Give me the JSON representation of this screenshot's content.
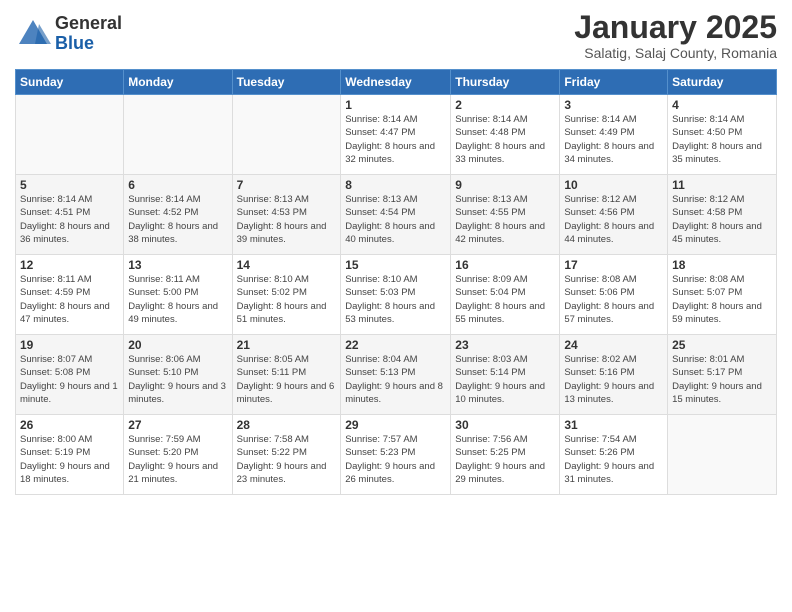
{
  "logo": {
    "general": "General",
    "blue": "Blue"
  },
  "title": "January 2025",
  "subtitle": "Salatig, Salaj County, Romania",
  "days_of_week": [
    "Sunday",
    "Monday",
    "Tuesday",
    "Wednesday",
    "Thursday",
    "Friday",
    "Saturday"
  ],
  "weeks": [
    [
      {
        "num": "",
        "info": ""
      },
      {
        "num": "",
        "info": ""
      },
      {
        "num": "",
        "info": ""
      },
      {
        "num": "1",
        "info": "Sunrise: 8:14 AM\nSunset: 4:47 PM\nDaylight: 8 hours and 32 minutes."
      },
      {
        "num": "2",
        "info": "Sunrise: 8:14 AM\nSunset: 4:48 PM\nDaylight: 8 hours and 33 minutes."
      },
      {
        "num": "3",
        "info": "Sunrise: 8:14 AM\nSunset: 4:49 PM\nDaylight: 8 hours and 34 minutes."
      },
      {
        "num": "4",
        "info": "Sunrise: 8:14 AM\nSunset: 4:50 PM\nDaylight: 8 hours and 35 minutes."
      }
    ],
    [
      {
        "num": "5",
        "info": "Sunrise: 8:14 AM\nSunset: 4:51 PM\nDaylight: 8 hours and 36 minutes."
      },
      {
        "num": "6",
        "info": "Sunrise: 8:14 AM\nSunset: 4:52 PM\nDaylight: 8 hours and 38 minutes."
      },
      {
        "num": "7",
        "info": "Sunrise: 8:13 AM\nSunset: 4:53 PM\nDaylight: 8 hours and 39 minutes."
      },
      {
        "num": "8",
        "info": "Sunrise: 8:13 AM\nSunset: 4:54 PM\nDaylight: 8 hours and 40 minutes."
      },
      {
        "num": "9",
        "info": "Sunrise: 8:13 AM\nSunset: 4:55 PM\nDaylight: 8 hours and 42 minutes."
      },
      {
        "num": "10",
        "info": "Sunrise: 8:12 AM\nSunset: 4:56 PM\nDaylight: 8 hours and 44 minutes."
      },
      {
        "num": "11",
        "info": "Sunrise: 8:12 AM\nSunset: 4:58 PM\nDaylight: 8 hours and 45 minutes."
      }
    ],
    [
      {
        "num": "12",
        "info": "Sunrise: 8:11 AM\nSunset: 4:59 PM\nDaylight: 8 hours and 47 minutes."
      },
      {
        "num": "13",
        "info": "Sunrise: 8:11 AM\nSunset: 5:00 PM\nDaylight: 8 hours and 49 minutes."
      },
      {
        "num": "14",
        "info": "Sunrise: 8:10 AM\nSunset: 5:02 PM\nDaylight: 8 hours and 51 minutes."
      },
      {
        "num": "15",
        "info": "Sunrise: 8:10 AM\nSunset: 5:03 PM\nDaylight: 8 hours and 53 minutes."
      },
      {
        "num": "16",
        "info": "Sunrise: 8:09 AM\nSunset: 5:04 PM\nDaylight: 8 hours and 55 minutes."
      },
      {
        "num": "17",
        "info": "Sunrise: 8:08 AM\nSunset: 5:06 PM\nDaylight: 8 hours and 57 minutes."
      },
      {
        "num": "18",
        "info": "Sunrise: 8:08 AM\nSunset: 5:07 PM\nDaylight: 8 hours and 59 minutes."
      }
    ],
    [
      {
        "num": "19",
        "info": "Sunrise: 8:07 AM\nSunset: 5:08 PM\nDaylight: 9 hours and 1 minute."
      },
      {
        "num": "20",
        "info": "Sunrise: 8:06 AM\nSunset: 5:10 PM\nDaylight: 9 hours and 3 minutes."
      },
      {
        "num": "21",
        "info": "Sunrise: 8:05 AM\nSunset: 5:11 PM\nDaylight: 9 hours and 6 minutes."
      },
      {
        "num": "22",
        "info": "Sunrise: 8:04 AM\nSunset: 5:13 PM\nDaylight: 9 hours and 8 minutes."
      },
      {
        "num": "23",
        "info": "Sunrise: 8:03 AM\nSunset: 5:14 PM\nDaylight: 9 hours and 10 minutes."
      },
      {
        "num": "24",
        "info": "Sunrise: 8:02 AM\nSunset: 5:16 PM\nDaylight: 9 hours and 13 minutes."
      },
      {
        "num": "25",
        "info": "Sunrise: 8:01 AM\nSunset: 5:17 PM\nDaylight: 9 hours and 15 minutes."
      }
    ],
    [
      {
        "num": "26",
        "info": "Sunrise: 8:00 AM\nSunset: 5:19 PM\nDaylight: 9 hours and 18 minutes."
      },
      {
        "num": "27",
        "info": "Sunrise: 7:59 AM\nSunset: 5:20 PM\nDaylight: 9 hours and 21 minutes."
      },
      {
        "num": "28",
        "info": "Sunrise: 7:58 AM\nSunset: 5:22 PM\nDaylight: 9 hours and 23 minutes."
      },
      {
        "num": "29",
        "info": "Sunrise: 7:57 AM\nSunset: 5:23 PM\nDaylight: 9 hours and 26 minutes."
      },
      {
        "num": "30",
        "info": "Sunrise: 7:56 AM\nSunset: 5:25 PM\nDaylight: 9 hours and 29 minutes."
      },
      {
        "num": "31",
        "info": "Sunrise: 7:54 AM\nSunset: 5:26 PM\nDaylight: 9 hours and 31 minutes."
      },
      {
        "num": "",
        "info": ""
      }
    ]
  ]
}
